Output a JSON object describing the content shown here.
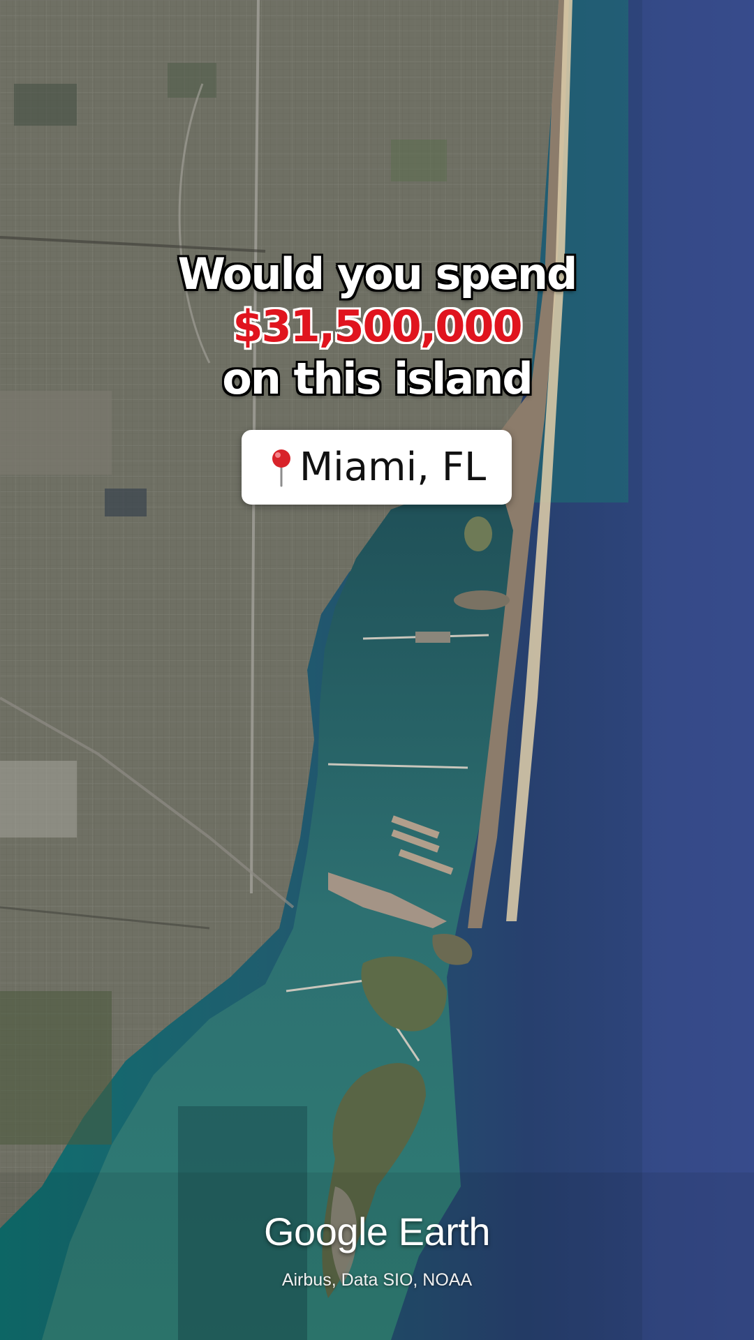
{
  "headline": {
    "line1": "Would you spend",
    "price": "$31,500,000",
    "line3": "on this island"
  },
  "location": {
    "label": "Miami, FL",
    "icon": "red-map-pin-icon"
  },
  "brand": {
    "word1": "Google",
    "word2": "Earth"
  },
  "attribution": "Airbus, Data SIO, NOAA",
  "colors": {
    "price_red": "#e0141e",
    "ocean_deep": "#33467f",
    "bay_water": "#2a6d6c",
    "land": "#6d6e62"
  }
}
